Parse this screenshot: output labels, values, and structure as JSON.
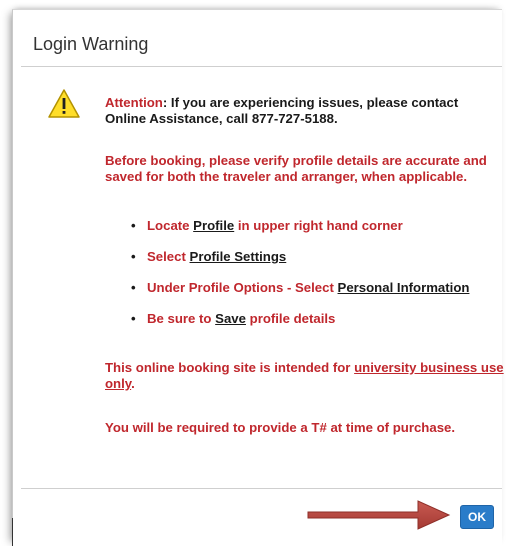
{
  "dialog": {
    "title": "Login Warning",
    "icon": "warning-triangle-icon",
    "attention": {
      "label": "Attention",
      "text": ": If you are experiencing issues, please contact Online Assistance, call 877-727-5188."
    },
    "verify_text": "Before booking, please verify profile details are accurate and saved for both the traveler and arranger, when applicable.",
    "steps": [
      {
        "before": "Locate ",
        "link": "Profile",
        "after": " in upper right hand corner"
      },
      {
        "before": "Select ",
        "link": "Profile Settings",
        "after": ""
      },
      {
        "before": "Under Profile Options - Select ",
        "link": "Personal Information",
        "after": ""
      },
      {
        "before": "Be sure to ",
        "link": "Save",
        "after": " profile details"
      }
    ],
    "intended": {
      "before": "This online booking site is intended for ",
      "link": "university business use only",
      "after": "."
    },
    "tnumber_text": "You will be required to provide a T# at time of purchase.",
    "ok_label": "OK"
  },
  "colors": {
    "warning_text": "#c0272d",
    "ok_button": "#2a7cc9",
    "annotation_arrow": "#b5473f",
    "warning_icon": "#ffde2a"
  }
}
